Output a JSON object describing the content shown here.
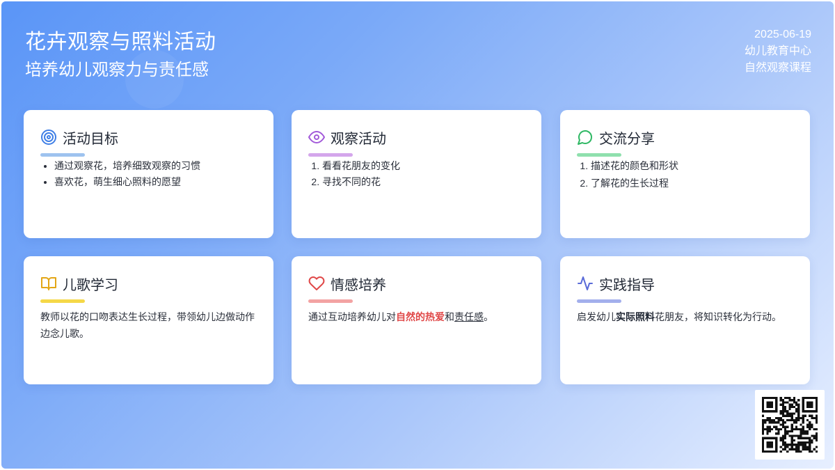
{
  "header": {
    "title": "花卉观察与照料活动",
    "subtitle": "培养幼儿观察力与责任感",
    "date": "2025-06-19",
    "org": "幼儿教育中心",
    "course": "自然观察课程"
  },
  "cards": {
    "goals": {
      "icon": "target-icon",
      "title": "活动目标",
      "accent": "#9ec3ef",
      "items": [
        "通过观察花，培养细致观察的习惯",
        "喜欢花，萌生细心照料的愿望"
      ]
    },
    "observe": {
      "icon": "eye-icon",
      "title": "观察活动",
      "accent": "#d4a6ec",
      "items": [
        "看看花朋友的变化",
        "寻找不同的花"
      ]
    },
    "share": {
      "icon": "chat-bubble-icon",
      "title": "交流分享",
      "accent": "#8fe0ad",
      "items": [
        "描述花的颜色和形状",
        "了解花的生长过程"
      ]
    },
    "song": {
      "icon": "open-book-icon",
      "title": "儿歌学习",
      "accent": "#f5d848",
      "text": "教师以花的口吻表达生长过程，带领幼儿边做动作边念儿歌。"
    },
    "emotion": {
      "icon": "heart-icon",
      "title": "情感培养",
      "accent": "#f3a3a3",
      "text_pre": "通过互动培养幼儿对",
      "text_hl": "自然的热爱",
      "text_mid": "和",
      "text_ul": "责任感",
      "text_post": "。"
    },
    "practice": {
      "icon": "pulse-icon",
      "title": "实践指导",
      "accent": "#a3afec",
      "text_pre": "启发幼儿",
      "text_bold": "实际照料",
      "text_post": "花朋友，将知识转化为行动。"
    }
  },
  "qr_code": {
    "icon": "qr-code-icon"
  }
}
